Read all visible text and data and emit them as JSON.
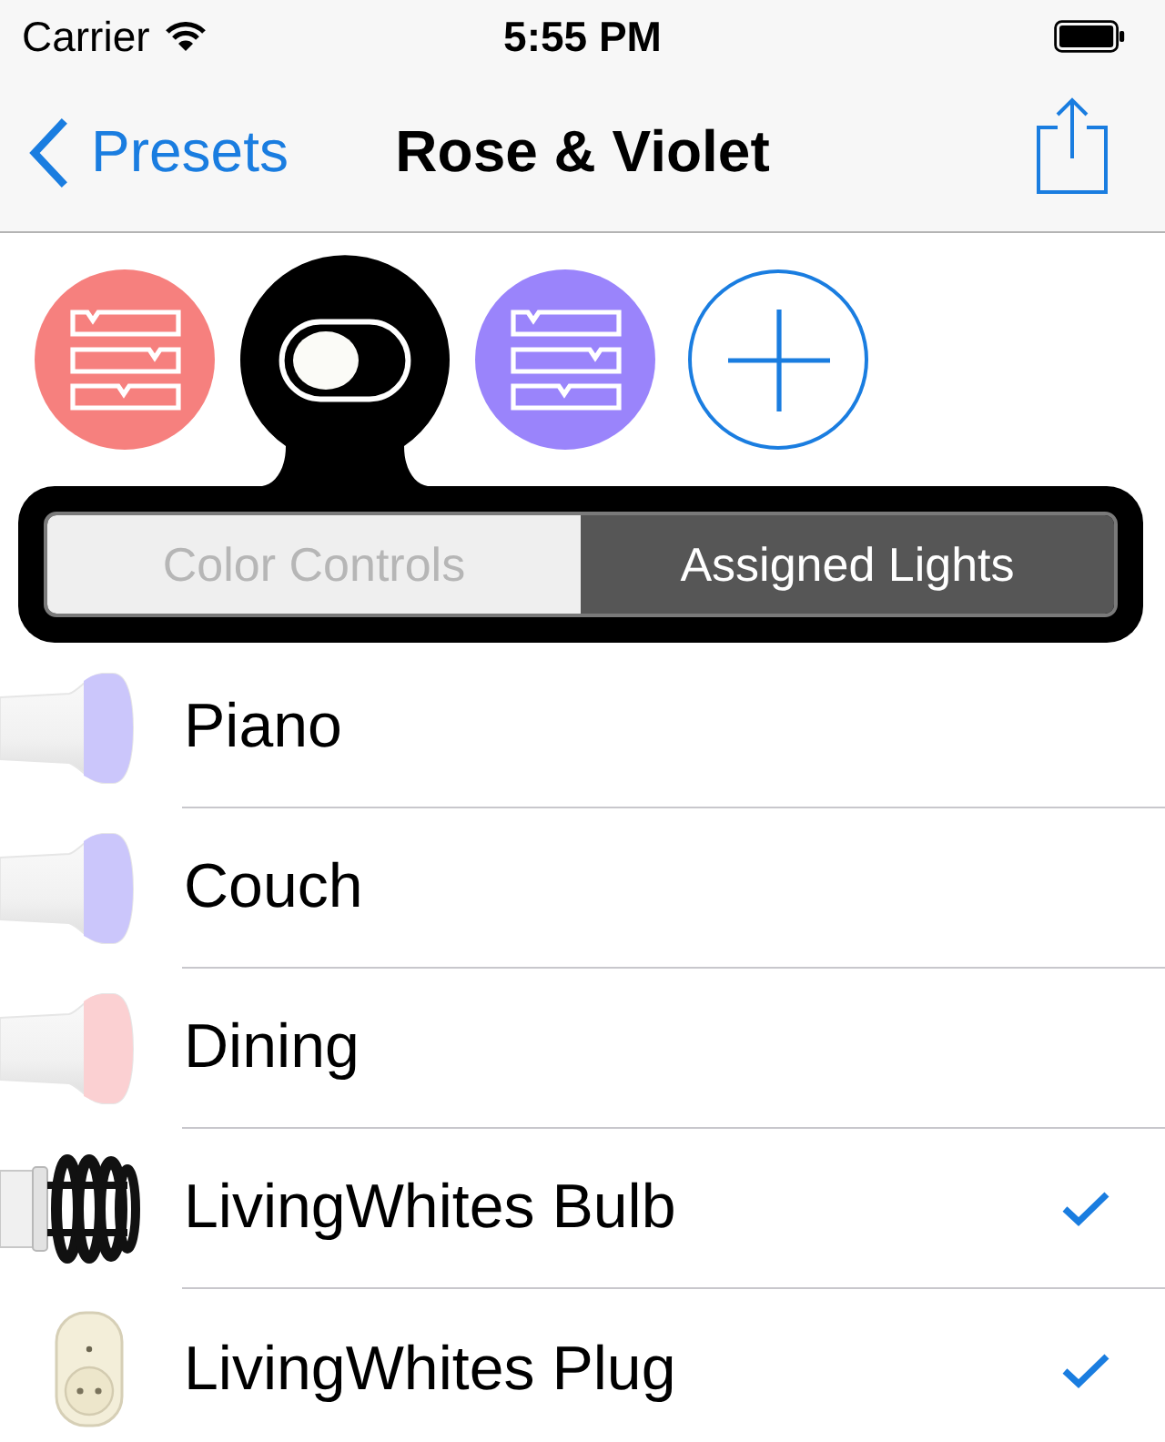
{
  "status_bar": {
    "carrier": "Carrier",
    "time": "5:55 PM"
  },
  "nav_bar": {
    "back_label": "Presets",
    "title": "Rose & Violet"
  },
  "presets": [
    {
      "kind": "list",
      "color": "#f6807e",
      "selected": false
    },
    {
      "kind": "toggle",
      "selected": true
    },
    {
      "kind": "list",
      "color": "#9a84fb",
      "selected": false
    },
    {
      "kind": "add"
    }
  ],
  "segments": [
    {
      "label": "Color Controls",
      "selected": false
    },
    {
      "label": "Assigned Lights",
      "selected": true
    }
  ],
  "lights": [
    {
      "name": "Piano",
      "kind": "bulb",
      "color": "#cbc6fb",
      "checked": false
    },
    {
      "name": "Couch",
      "kind": "bulb",
      "color": "#cbc6fb",
      "checked": false
    },
    {
      "name": "Dining",
      "kind": "bulb",
      "color": "#fbd0d2",
      "checked": false
    },
    {
      "name": "LivingWhites Bulb",
      "kind": "spiral",
      "checked": true
    },
    {
      "name": "LivingWhites Plug",
      "kind": "plug",
      "checked": true
    }
  ]
}
